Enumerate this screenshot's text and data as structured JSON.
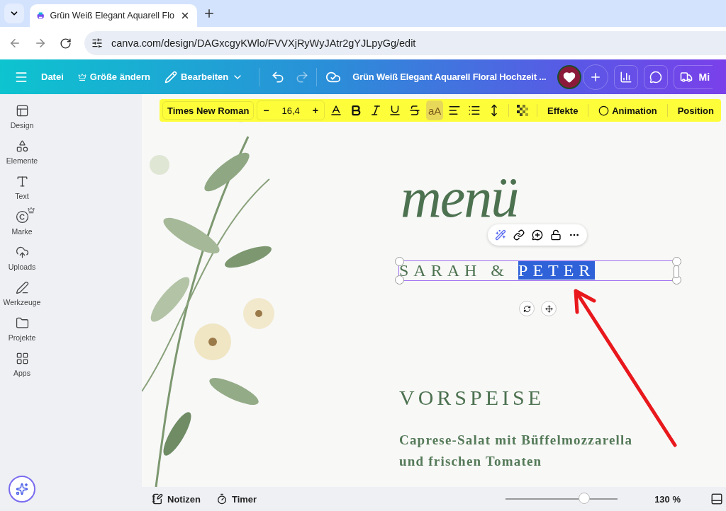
{
  "browser": {
    "tab_title": "Grün Weiß Elegant Aquarell Flo",
    "url": "canva.com/design/DAGxcgyKWlo/FVVXjRyWyJAtr2gYJLpyGg/edit"
  },
  "header": {
    "menu_items": [
      {
        "kind": "file",
        "label": "Datei"
      },
      {
        "kind": "resize",
        "label": "Größe ändern"
      },
      {
        "kind": "edit",
        "label": "Bearbeiten"
      }
    ],
    "title": "Grün Weiß Elegant Aquarell Floral Hochzeit ...",
    "cut_button": "Mi"
  },
  "sidebar": {
    "items": [
      {
        "kind": "design",
        "label": "Design"
      },
      {
        "kind": "elements",
        "label": "Elemente"
      },
      {
        "kind": "text",
        "label": "Text"
      },
      {
        "kind": "brand",
        "label": "Marke"
      },
      {
        "kind": "uploads",
        "label": "Uploads"
      },
      {
        "kind": "tools",
        "label": "Werkzeuge"
      },
      {
        "kind": "projects",
        "label": "Projekte"
      },
      {
        "kind": "apps",
        "label": "Apps"
      }
    ]
  },
  "toolbar": {
    "font": "Times New Roman",
    "size": {
      "minus": "−",
      "value": "16,4",
      "plus": "+"
    },
    "format_buttons": [
      {
        "kind": "color",
        "selected": false
      },
      {
        "kind": "bold",
        "selected": false
      },
      {
        "kind": "italic",
        "selected": false
      },
      {
        "kind": "underline",
        "selected": false
      },
      {
        "kind": "strike",
        "selected": false
      },
      {
        "kind": "case",
        "label": "aA",
        "selected": true
      },
      {
        "kind": "align",
        "selected": false
      },
      {
        "kind": "list",
        "selected": false
      },
      {
        "kind": "spacing",
        "selected": false
      },
      {
        "kind": "transparency",
        "selected": false
      }
    ],
    "text_buttons": [
      {
        "kind": "effects",
        "label": "Effekte"
      },
      {
        "kind": "animation",
        "label": "Animation"
      },
      {
        "kind": "position",
        "label": "Position"
      }
    ]
  },
  "design": {
    "title": "menü",
    "names": [
      {
        "text": "SARAH & ",
        "selected": false
      },
      {
        "text": "PETER",
        "selected": true
      }
    ],
    "heading": "VORSPEISE",
    "dish": [
      "Caprese-Salat mit Büffelmozzarella",
      "und frischen Tomaten"
    ]
  },
  "footer": {
    "notes": "Notizen",
    "timer": "Timer",
    "zoom": {
      "level": 0.7,
      "reading": "130 %"
    }
  }
}
